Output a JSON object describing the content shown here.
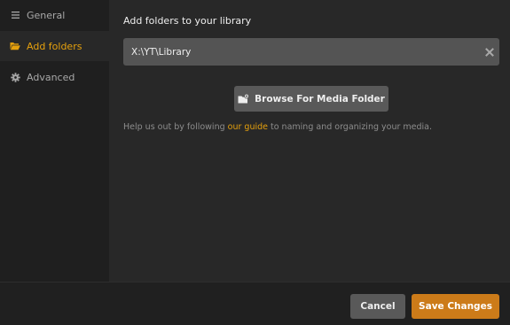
{
  "sidebar": {
    "items": [
      {
        "label": "General",
        "icon": "menu-lines-icon",
        "active": false
      },
      {
        "label": "Add folders",
        "icon": "folder-open-icon",
        "active": true
      },
      {
        "label": "Advanced",
        "icon": "gear-icon",
        "active": false
      }
    ]
  },
  "main": {
    "title": "Add folders to your library",
    "folder_field": {
      "value": "X:\\YT\\Library"
    },
    "browse_label": "Browse For Media Folder",
    "help": {
      "before": "Help us out by following ",
      "link": "our guide",
      "after": " to naming and organizing your media."
    }
  },
  "footer": {
    "cancel_label": "Cancel",
    "save_label": "Save Changes"
  },
  "colors": {
    "accent": "#e5a00d",
    "save_button": "#cc7b19",
    "sidebar_bg": "#1f1f1f",
    "content_bg": "#282828"
  }
}
